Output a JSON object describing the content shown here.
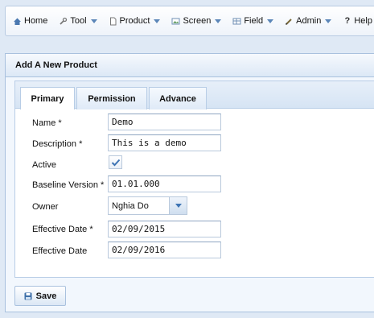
{
  "menu": [
    {
      "label": "Home",
      "icon": "home-icon",
      "has_caret": false
    },
    {
      "label": "Tool",
      "icon": "wrench-icon",
      "has_caret": true
    },
    {
      "label": "Product",
      "icon": "document-icon",
      "has_caret": true
    },
    {
      "label": "Screen",
      "icon": "image-icon",
      "has_caret": true
    },
    {
      "label": "Field",
      "icon": "table-icon",
      "has_caret": true
    },
    {
      "label": "Admin",
      "icon": "pencil-icon",
      "has_caret": true
    },
    {
      "label": "Help",
      "icon": "question-icon",
      "has_caret": true
    }
  ],
  "panel": {
    "title": "Add A New Product"
  },
  "tabs": {
    "primary": "Primary",
    "permission": "Permission",
    "advance": "Advance",
    "active": "Primary"
  },
  "form": {
    "name_label": "Name *",
    "name_value": "Demo",
    "description_label": "Description *",
    "description_value": "This is a demo",
    "active_label": "Active",
    "active_checked": true,
    "baseline_label": "Baseline Version *",
    "baseline_value": "01.01.000",
    "owner_label": "Owner",
    "owner_value": "Nghia Do",
    "effective_date_req_label": "Effective Date *",
    "effective_date_req_value": "02/09/2015",
    "effective_date_label": "Effective Date",
    "effective_date_value": "02/09/2016"
  },
  "footer": {
    "save_label": "Save"
  },
  "colors": {
    "accent": "#3d74b4",
    "panel_border": "#a9c1de",
    "background": "#dfe9f5"
  }
}
